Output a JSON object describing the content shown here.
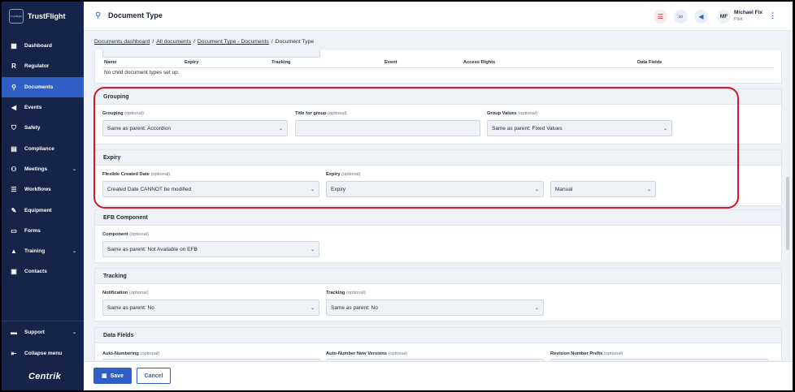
{
  "sidebar": {
    "brand_logo": "TrustFlight",
    "brand_name": "TrustFlight",
    "items": [
      {
        "label": "Dashboard",
        "icon": "dashboard-icon"
      },
      {
        "label": "Regulator",
        "icon": "regulator-icon"
      },
      {
        "label": "Documents",
        "icon": "paperclip-icon"
      },
      {
        "label": "Events",
        "icon": "megaphone-icon"
      },
      {
        "label": "Safety",
        "icon": "shield-icon"
      },
      {
        "label": "Compliance",
        "icon": "clipboard-icon"
      },
      {
        "label": "Meetings",
        "icon": "meetings-icon"
      },
      {
        "label": "Workflows",
        "icon": "workflow-icon"
      },
      {
        "label": "Equipment",
        "icon": "wrench-icon"
      },
      {
        "label": "Forms",
        "icon": "forms-icon"
      },
      {
        "label": "Training",
        "icon": "graduation-cap-icon"
      },
      {
        "label": "Contacts",
        "icon": "contacts-icon"
      }
    ],
    "support_label": "Support",
    "collapse_label": "Collapse menu",
    "footer_logo": "Centrik"
  },
  "topbar": {
    "title": "Document Type",
    "user_initials": "MF",
    "user_name": "Michael Fix",
    "user_role": "Pilot"
  },
  "breadcrumb": {
    "item1": "Documents dashboard",
    "item2": "All documents",
    "item3": "Document Type - Documents",
    "current": "Document Type",
    "separator": "/"
  },
  "child_types": {
    "columns": [
      "Name",
      "Expiry",
      "Tracking",
      "Event",
      "Access Rights",
      "Data Fields"
    ],
    "empty_text": "No child document types set up."
  },
  "grouping": {
    "title": "Grouping",
    "grouping_label": "Grouping",
    "grouping_value": "Same as parent: Accordion",
    "title_group_label": "Title for group",
    "title_group_value": "",
    "group_values_label": "Group Values",
    "group_values_value": "Same as parent: Fixed Values"
  },
  "expiry": {
    "title": "Expiry",
    "flex_label": "Flexible Created Date",
    "flex_value": "Created Date CANNOT be modified",
    "expiry_label": "Expiry",
    "expiry_value": "Expiry",
    "mode_value": "Manual"
  },
  "efb": {
    "title": "EFB Component",
    "component_label": "Component",
    "component_value": "Same as parent: Not Available on EFB"
  },
  "tracking": {
    "title": "Tracking",
    "notification_label": "Notification",
    "notification_value": "Same as parent: No",
    "tracking_label": "Tracking",
    "tracking_value": "Same as parent: No"
  },
  "data_fields": {
    "title": "Data Fields",
    "auto_numbering_label": "Auto-Numbering",
    "auto_number_versions_label": "Auto-Number New Versions",
    "revision_prefix_label": "Revision Number Prefix"
  },
  "optional_text": "(optional)",
  "footer": {
    "save_label": "Save",
    "cancel_label": "Cancel"
  }
}
